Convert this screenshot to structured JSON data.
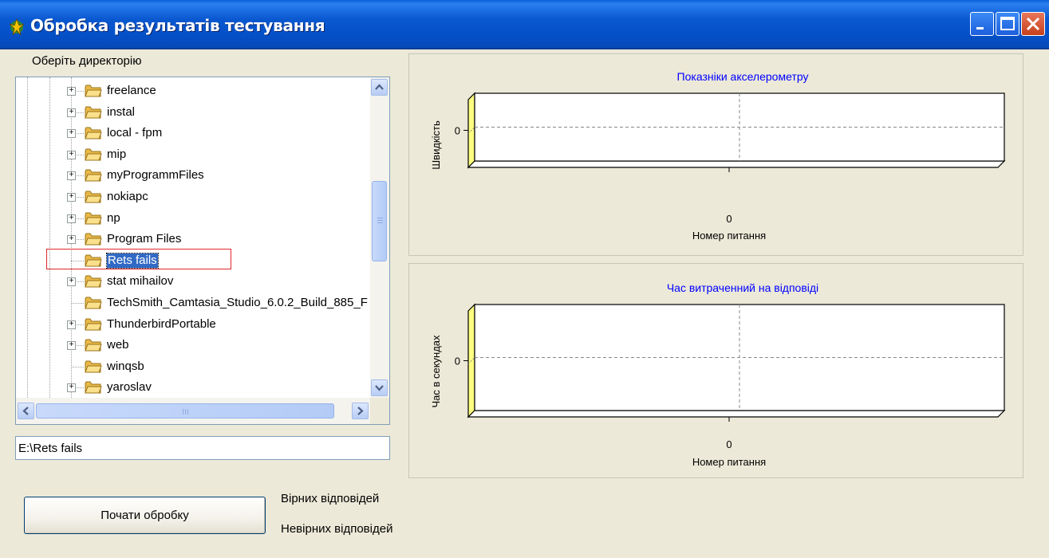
{
  "window": {
    "title": "Обробка результатів тестування",
    "controls": [
      "minimize",
      "maximize",
      "close"
    ]
  },
  "directory_label": "Оберіть директорію",
  "tree": {
    "items": [
      {
        "label": "freelance",
        "expandable": true
      },
      {
        "label": "instal",
        "expandable": true
      },
      {
        "label": "local - fpm",
        "expandable": true
      },
      {
        "label": "mip",
        "expandable": true
      },
      {
        "label": "myProgrammFiles",
        "expandable": true
      },
      {
        "label": "nokiapc",
        "expandable": true
      },
      {
        "label": "np",
        "expandable": true
      },
      {
        "label": "Program Files",
        "expandable": true
      },
      {
        "label": "Rets fails",
        "expandable": false,
        "selected": true
      },
      {
        "label": "stat mihailov",
        "expandable": true
      },
      {
        "label": "TechSmith_Camtasia_Studio_6.0.2_Build_885_F",
        "expandable": false
      },
      {
        "label": "ThunderbirdPortable",
        "expandable": true
      },
      {
        "label": "web",
        "expandable": true
      },
      {
        "label": "winqsb",
        "expandable": false
      },
      {
        "label": "yaroslav",
        "expandable": true
      }
    ],
    "vscroll_position": 0.6,
    "hscroll_position": 0.0
  },
  "path_field": {
    "value": "E:\\Rets fails"
  },
  "start_button": {
    "label": "Почати обробку"
  },
  "stats": {
    "correct_label": "Вірних відповідей",
    "incorrect_label": "Невірних відповідей"
  },
  "colors": {
    "titlebar": "#0451c9",
    "chart_title": "#0000ff",
    "chart_wall": "#ffff80",
    "selection": "#316ac5",
    "highlight_box": "#e0282c"
  },
  "chart_data": [
    {
      "type": "bar",
      "title": "Показніки акселерометру",
      "xlabel": "Номер питання",
      "ylabel": "Швидкість",
      "x_ticks": [
        "0"
      ],
      "y_ticks": [
        "0"
      ],
      "categories": [],
      "values": [],
      "grid": true,
      "view3d": true
    },
    {
      "type": "bar",
      "title": "Час витраченний на відповіді",
      "xlabel": "Номер питання",
      "ylabel": "Час в секундах",
      "x_ticks": [
        "0"
      ],
      "y_ticks": [
        "0"
      ],
      "categories": [],
      "values": [],
      "grid": true,
      "view3d": true
    }
  ]
}
